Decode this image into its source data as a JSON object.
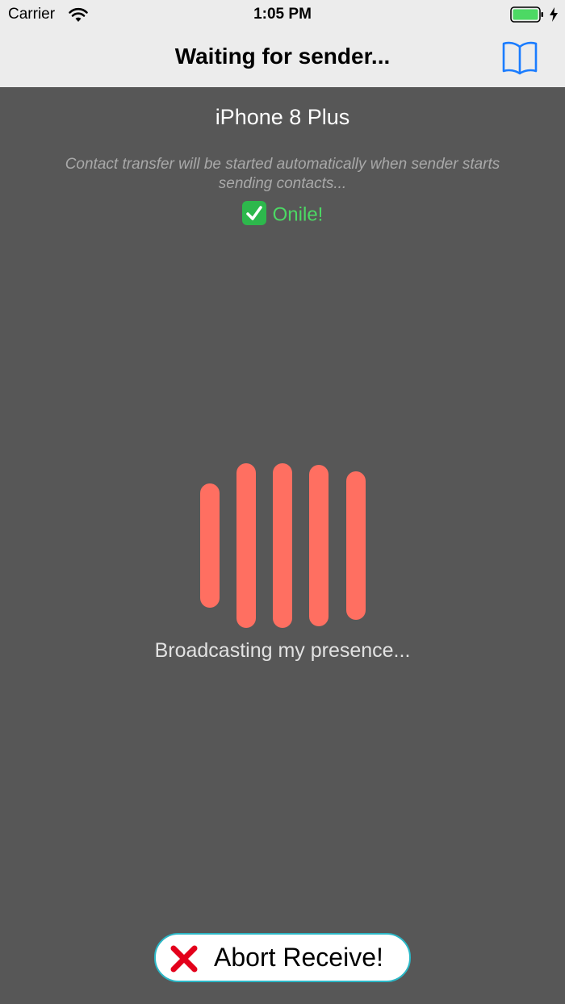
{
  "status_bar": {
    "carrier": "Carrier",
    "time": "1:05 PM"
  },
  "nav": {
    "title": "Waiting for sender...",
    "book_icon": "book-icon"
  },
  "main": {
    "device_name": "iPhone 8 Plus",
    "info_text": "Contact transfer will be started automatically when sender starts sending contacts...",
    "online_text": "Onile!",
    "broadcast_text": "Broadcasting my presence..."
  },
  "abort_button": {
    "label": "Abort Receive!"
  },
  "colors": {
    "background": "#575757",
    "nav_background": "#ececec",
    "accent_blue": "#1a7cff",
    "online_green": "#4cd964",
    "bar_color": "#ff6f61",
    "abort_red": "#e3001b"
  }
}
